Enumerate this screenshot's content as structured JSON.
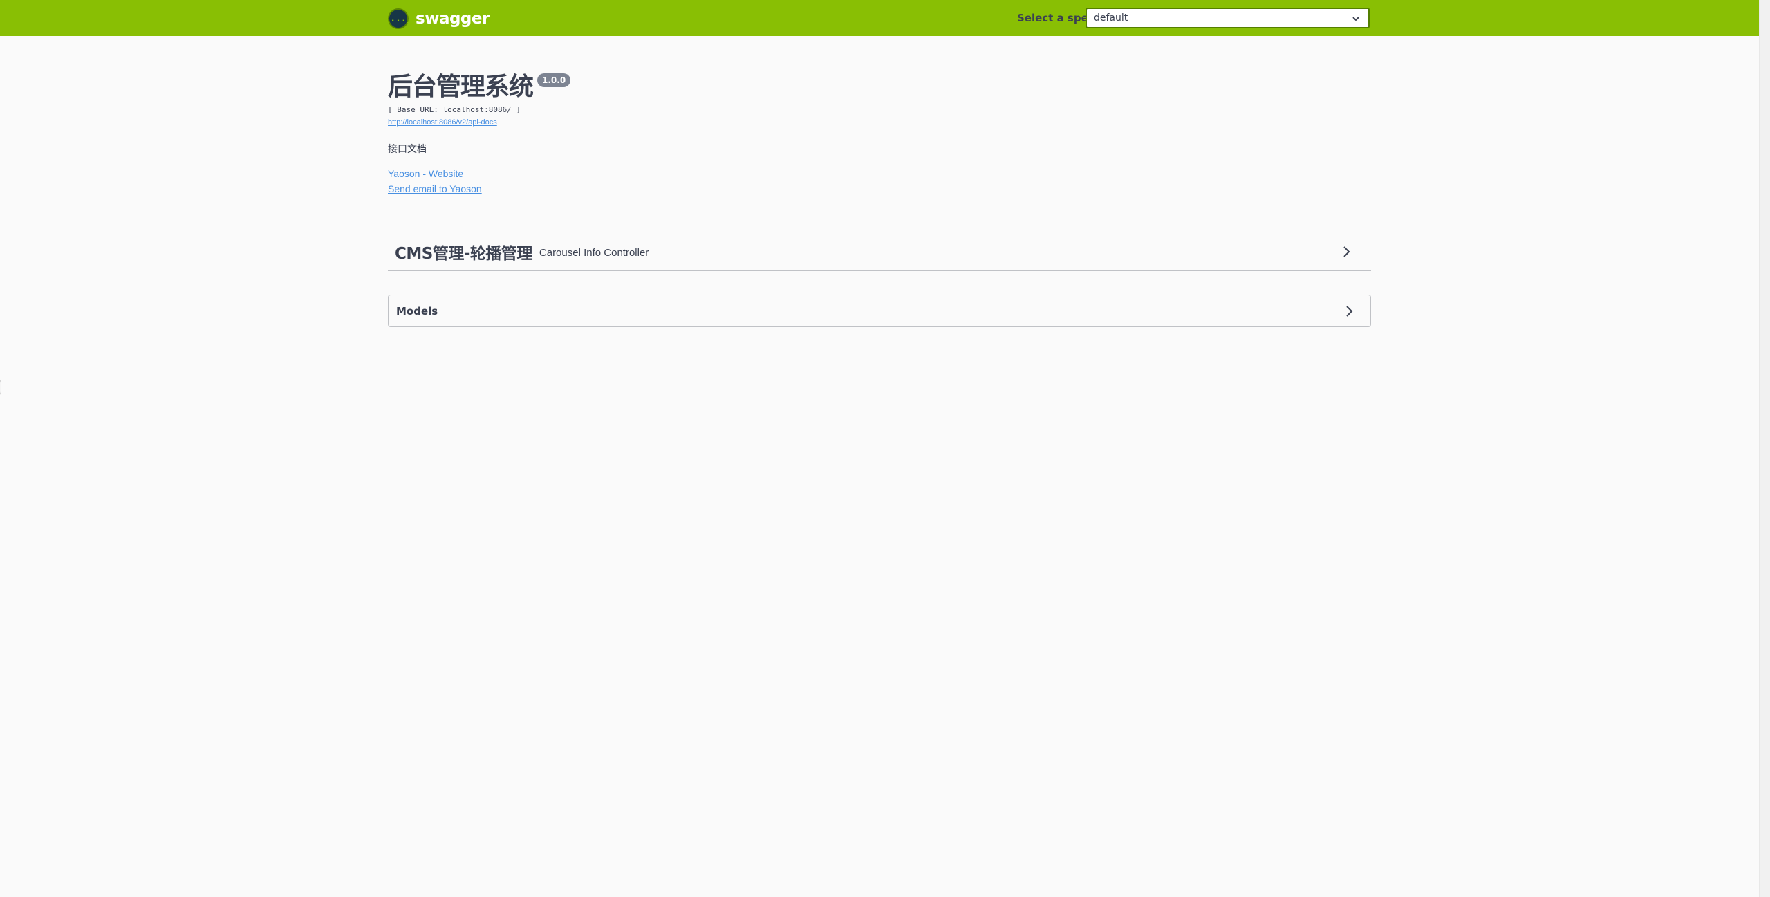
{
  "topbar": {
    "logo_glyph": "{...}",
    "logo_text": "swagger",
    "spec_label": "Select a spec",
    "spec_selected": "default",
    "bg_color": "#89bf04"
  },
  "info": {
    "title": "后台管理系统",
    "version": "1.0.0",
    "base_url": "[ Base URL: localhost:8086/ ]",
    "spec_url": "http://localhost:8086/v2/api-docs",
    "description": "接口文档",
    "contact_website": "Yaoson - Website",
    "contact_email": "Send email to Yaoson"
  },
  "tags": [
    {
      "name": "CMS管理-轮播管理",
      "description": "Carousel Info Controller"
    }
  ],
  "models": {
    "title": "Models"
  },
  "icons": {
    "logo": "swagger-logo-icon",
    "spec_dropdown": "chevron-down-icon",
    "tag_expand": "chevron-right-icon",
    "models_expand": "chevron-right-icon"
  }
}
